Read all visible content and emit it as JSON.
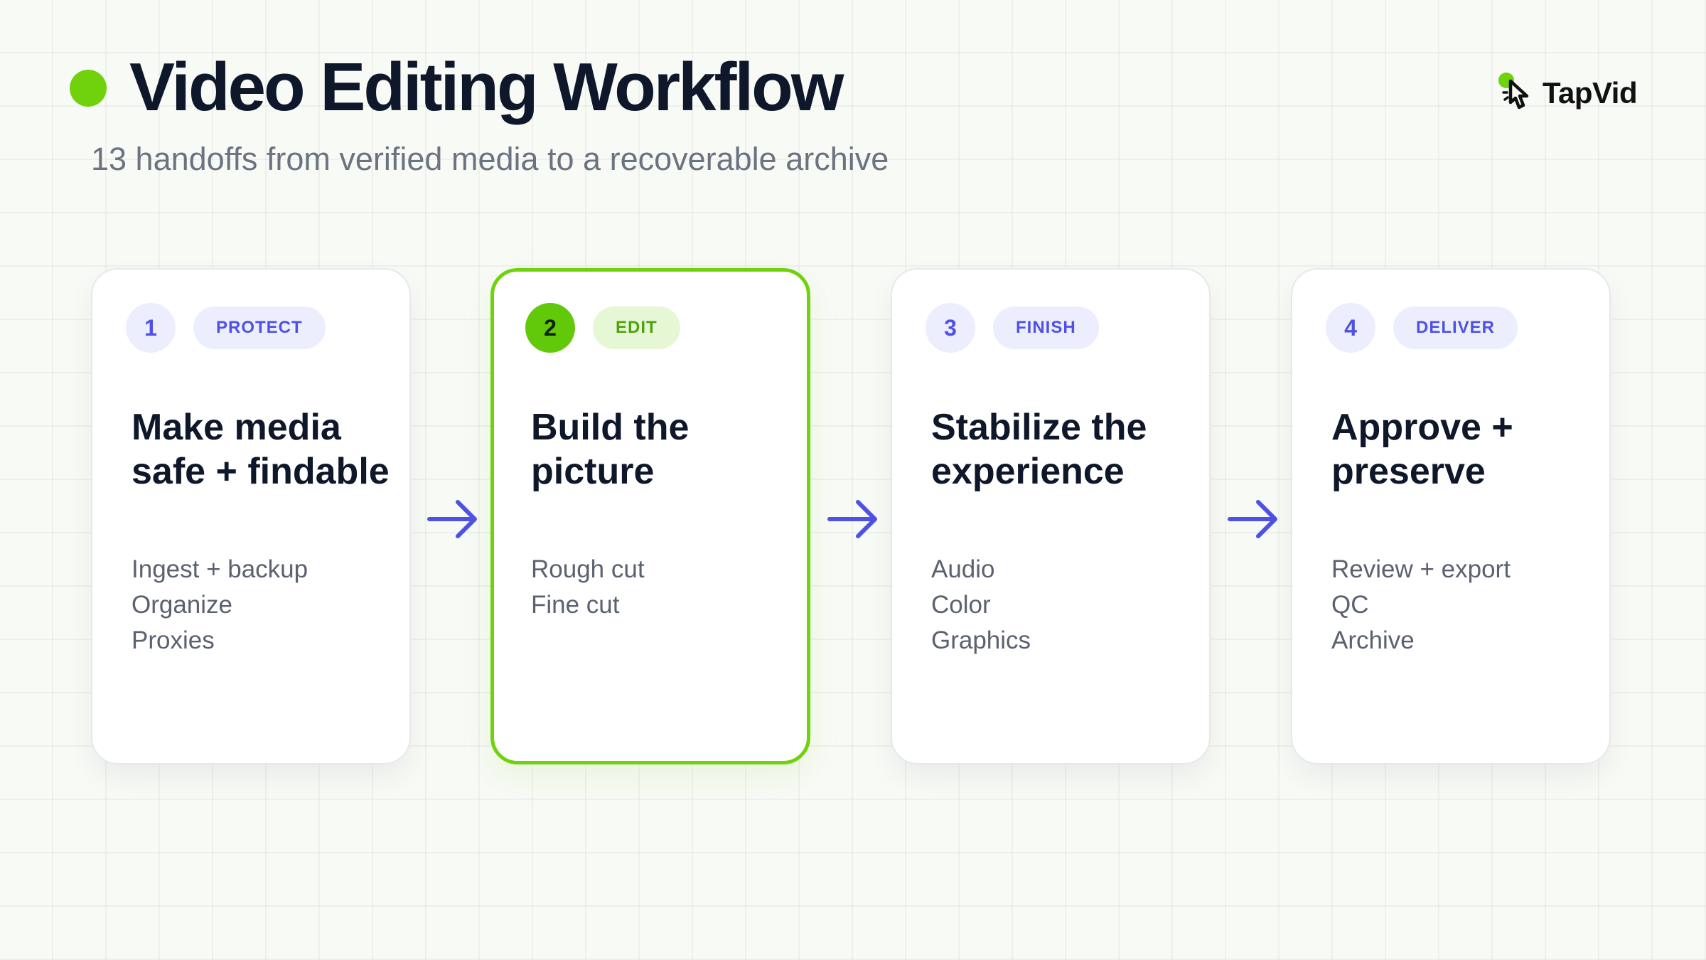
{
  "header": {
    "title": "Video Editing Workflow",
    "subtitle": "13 handoffs from verified media to a recoverable archive"
  },
  "logo": {
    "text": "TapVid",
    "icon": "pointer-hand-icon"
  },
  "colors": {
    "accent_green": "#6fd20c",
    "accent_indigo": "#4f51e6",
    "chip_indigo_bg": "#eceefe",
    "chip_green_bg": "#e6f7d6",
    "title_dark": "#0f172a",
    "muted_text": "#5b6170"
  },
  "flow": {
    "connector_icon": "arrow-right-icon",
    "steps": [
      {
        "number": "1",
        "tag": "PROTECT",
        "title": "Make media\nsafe + findable",
        "items": [
          "Ingest + backup",
          "Organize",
          "Proxies"
        ],
        "active": false
      },
      {
        "number": "2",
        "tag": "EDIT",
        "title": "Build the\npicture",
        "items": [
          "Rough cut",
          "Fine cut"
        ],
        "active": true
      },
      {
        "number": "3",
        "tag": "FINISH",
        "title": "Stabilize the\nexperience",
        "items": [
          "Audio",
          "Color",
          "Graphics"
        ],
        "active": false
      },
      {
        "number": "4",
        "tag": "DELIVER",
        "title": "Approve +\npreserve",
        "items": [
          "Review + export",
          "QC",
          "Archive"
        ],
        "active": false
      }
    ]
  }
}
